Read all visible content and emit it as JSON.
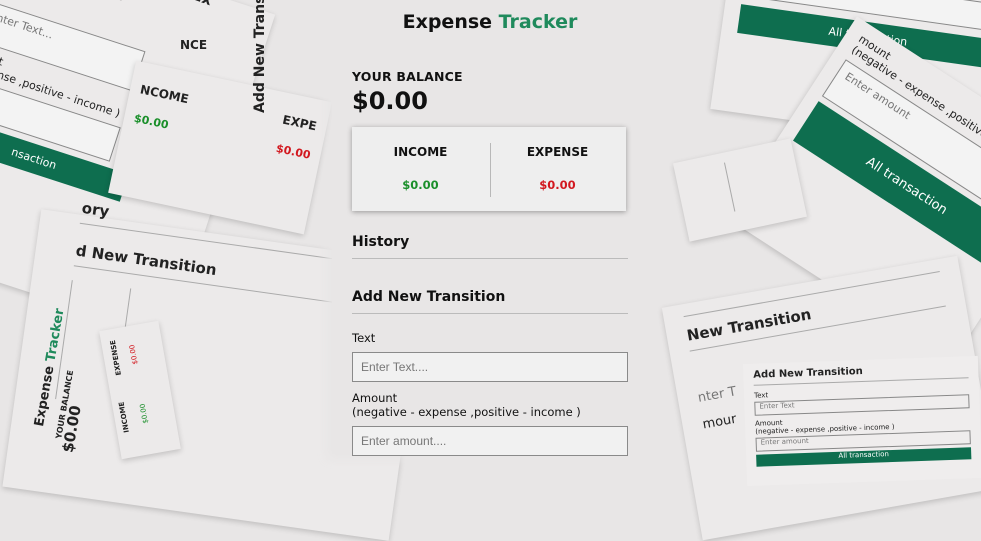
{
  "app": {
    "title_part1": "Expense",
    "title_part2": "Tracker",
    "title_accent_color": "#1f8a5c"
  },
  "balance": {
    "label": "YOUR BALANCE",
    "value": "$0.00"
  },
  "summary": {
    "income_label": "INCOME",
    "income_value": "$0.00",
    "income_color": "#1a8f2a",
    "expense_label": "EXPENSE",
    "expense_value": "$0.00",
    "expense_color": "#d2181f"
  },
  "history": {
    "heading": "History"
  },
  "add_form": {
    "heading": "Add New Transition",
    "text_label": "Text",
    "text_placeholder": "Enter Text....",
    "amount_label": "Amount",
    "amount_hint": "(negative - expense ,positive - income )",
    "amount_placeholder": "Enter amount....",
    "all_transaction_button": "All transaction",
    "button_color": "#0e6e4f"
  },
  "ghost": {
    "ncome": "NCOME",
    "expe": "EXPE",
    "ory": "ory",
    "d_new_transition": "d New Transition",
    "enter_text_short": "Enter Text...",
    "mount": "mount",
    "hint_short": "- expense ,positive - income )",
    "nsaction": "nsaction",
    "ex": "Ex",
    "nce": "NCE",
    "enter_amount_short": "Enter amount",
    "negative_hint": "(negative - expense ,positive - income )",
    "ew_transition": "New Transition",
    "nter": "nter T",
    "mour": "mour",
    "enter_text_small": "Enter Text",
    "enter_amount_small": "Enter amount",
    "transaction_small": "All transaction"
  }
}
